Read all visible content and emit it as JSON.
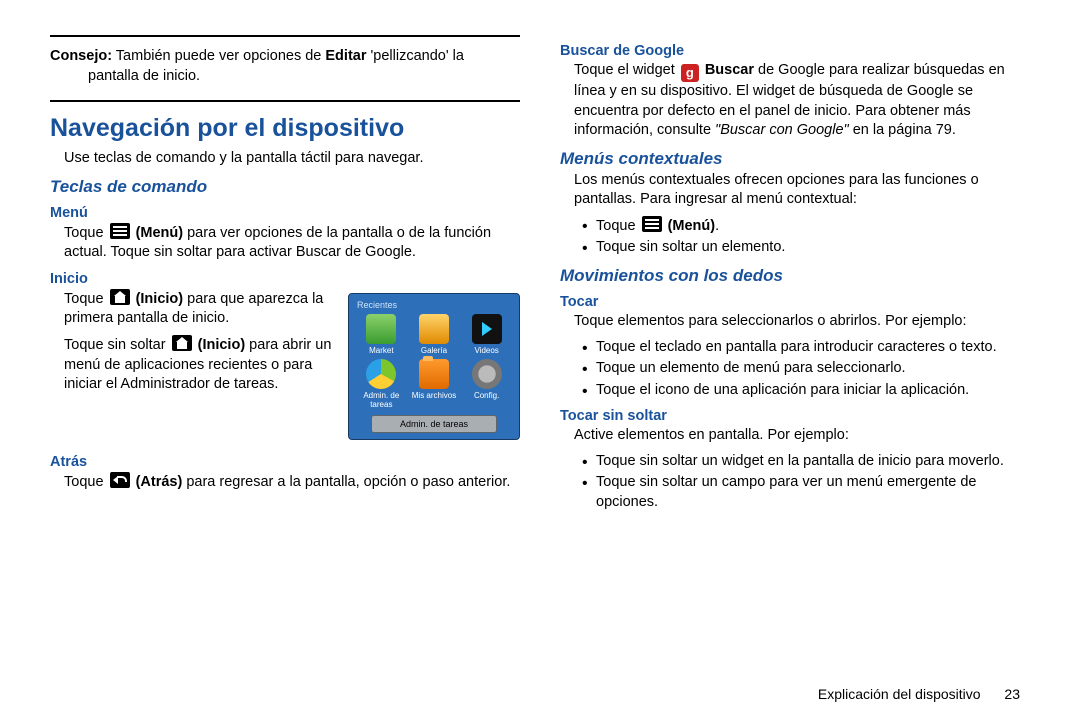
{
  "left": {
    "consejo_label": "Consejo:",
    "consejo_text1": " También puede ver opciones de ",
    "consejo_bold": "Editar",
    "consejo_text2": " 'pellizcando' la",
    "consejo_line2": "pantalla de inicio.",
    "h1": "Navegación por el dispositivo",
    "intro": "Use teclas de comando y la pantalla táctil para navegar.",
    "h2_teclas": "Teclas de comando",
    "menu_h": "Menú",
    "menu_t1": "Toque ",
    "menu_b": " (Menú)",
    "menu_t2": " para ver opciones de la pantalla o de la función actual. Toque sin soltar para activar Buscar de Google.",
    "inicio_h": "Inicio",
    "inicio_t1": "Toque ",
    "inicio_b": " (Inicio)",
    "inicio_t2": " para que aparezca la primera pantalla de inicio.",
    "inicio_t3": "Toque sin soltar ",
    "inicio_b2": " (Inicio)",
    "inicio_t4": " para abrir un menú de aplicaciones recientes o para iniciar el Administrador de tareas.",
    "atras_h": "Atrás",
    "atras_t1": "Toque ",
    "atras_b": " (Atrás)",
    "atras_t2": " para regresar a la pantalla, opción o paso anterior."
  },
  "recents": {
    "title": "Recientes",
    "apps": [
      "Market",
      "Galería",
      "Videos",
      "Admin. de tareas",
      "Mis archivos",
      "Config."
    ],
    "button": "Admin. de tareas"
  },
  "right": {
    "buscar_h": "Buscar de Google",
    "buscar_t1": "Toque el widget ",
    "buscar_b": " Buscar",
    "buscar_t2": " de Google para realizar búsquedas en línea y en su dispositivo. El widget de búsqueda de Google se encuentra por defecto en el panel de inicio. Para obtener más información, consulte ",
    "buscar_q": "\"Buscar con Google\"",
    "buscar_t3": " en la página 79.",
    "menus_h": "Menús contextuales",
    "menus_p": "Los menús contextuales ofrecen opciones para las funciones o pantallas. Para ingresar al menú contextual:",
    "menus_b1a": "Toque ",
    "menus_b1b": " (Menú)",
    "menus_b1c": ".",
    "menus_b2": "Toque sin soltar un elemento.",
    "mov_h": "Movimientos con los dedos",
    "tocar_h": "Tocar",
    "tocar_p": "Toque elementos para seleccionarlos o abrirlos. Por ejemplo:",
    "tocar_b1": "Toque el teclado en pantalla para introducir caracteres o texto.",
    "tocar_b2": "Toque un elemento de menú para seleccionarlo.",
    "tocar_b3": "Toque el icono de una aplicación para iniciar la aplicación.",
    "tss_h": "Tocar sin soltar",
    "tss_p": "Active elementos en pantalla. Por ejemplo:",
    "tss_b1": "Toque sin soltar un widget en la pantalla de inicio para moverlo.",
    "tss_b2": "Toque sin soltar un campo para ver un menú emergente de opciones."
  },
  "footer": {
    "label": "Explicación del dispositivo",
    "page": "23"
  }
}
